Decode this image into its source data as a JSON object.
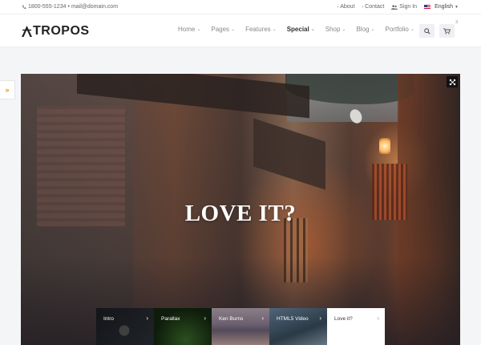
{
  "topbar": {
    "phone": "1800-555-1234",
    "separator": "•",
    "email": "mail@domain.com",
    "about": "About",
    "contact": "Contact",
    "signin": "Sign In",
    "language": "English"
  },
  "header": {
    "logo_rest": "TROPOS",
    "nav": [
      {
        "label": "Home"
      },
      {
        "label": "Pages"
      },
      {
        "label": "Features"
      },
      {
        "label": "Special"
      },
      {
        "label": "Shop"
      },
      {
        "label": "Blog"
      },
      {
        "label": "Portfolio"
      }
    ],
    "cart_count": "3"
  },
  "sidetab": {
    "icon": "»"
  },
  "hero": {
    "title": "LOVE IT?",
    "thumbnails": [
      {
        "label": "Intro"
      },
      {
        "label": "Parallax"
      },
      {
        "label": "Ken Burns"
      },
      {
        "label": "HTML5 Video"
      },
      {
        "label": "Love it?"
      }
    ],
    "arrow": "›"
  },
  "colors": {
    "accent": "#e8912d",
    "header_bg": "#ffffff",
    "page_bg": "#f4f5f7"
  }
}
